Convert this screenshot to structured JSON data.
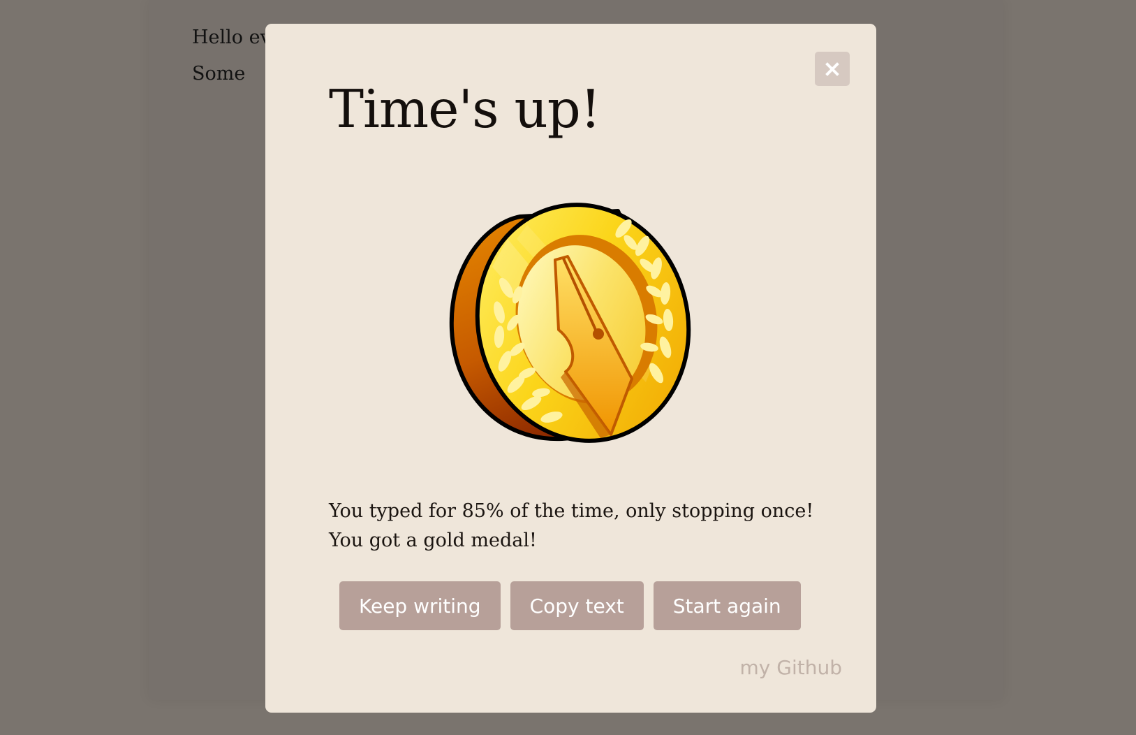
{
  "background_document": {
    "lines": [
      "Hello every",
      "Some"
    ]
  },
  "modal": {
    "close_icon": "close-icon",
    "title": "Time's up!",
    "medal_icon": "gold-medal-pen-icon",
    "result_line_1": "You typed for 85% of the time, only stopping once!",
    "result_line_2": "You got a gold medal!",
    "buttons": {
      "keep_writing": "Keep writing",
      "copy_text": "Copy text",
      "start_again": "Start again"
    },
    "footer_link": "my Github"
  },
  "colors": {
    "overlay": "#7a746e",
    "modal_bg": "#efe6da",
    "button_bg": "#b7a099",
    "button_text": "#ffffff",
    "link": "#c1b2a8",
    "gold": "#f5c518"
  }
}
